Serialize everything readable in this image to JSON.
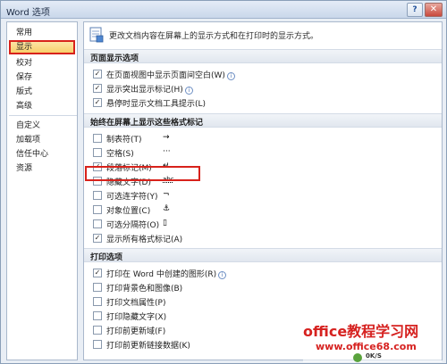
{
  "window": {
    "title": "Word 选项",
    "help": "?",
    "close": "✕"
  },
  "sidebar": {
    "items": [
      {
        "label": "常用"
      },
      {
        "label": "显示"
      },
      {
        "label": "校对"
      },
      {
        "label": "保存"
      },
      {
        "label": "版式"
      },
      {
        "label": "高级"
      },
      {
        "label": "自定义"
      },
      {
        "label": "加载项"
      },
      {
        "label": "信任中心"
      },
      {
        "label": "资源"
      }
    ],
    "selected": "显示"
  },
  "main": {
    "banner_text": "更改文档内容在屏幕上的显示方式和在打印时的显示方式。",
    "sections": [
      {
        "title": "页面显示选项",
        "options": [
          {
            "label": "在页面视图中显示页面间空白(W)",
            "checked": true,
            "info": true
          },
          {
            "label": "显示突出显示标记(H)",
            "checked": true,
            "info": true
          },
          {
            "label": "悬停时显示文档工具提示(L)",
            "checked": true,
            "info": false
          }
        ]
      },
      {
        "title": "始终在屏幕上显示这些格式标记",
        "options": [
          {
            "label": "制表符(T)",
            "checked": false,
            "mark": "→"
          },
          {
            "label": "空格(S)",
            "checked": false,
            "mark": "···"
          },
          {
            "label": "段落标记(M)",
            "checked": true,
            "mark": "↵"
          },
          {
            "label": "隐藏文字(D)",
            "checked": false,
            "mark": "abc"
          },
          {
            "label": "可选连字符(Y)",
            "checked": false,
            "mark": "¬"
          },
          {
            "label": "对象位置(C)",
            "checked": false,
            "mark": "⚓"
          },
          {
            "label": "可选分隔符(O)",
            "checked": false,
            "mark": "▯"
          },
          {
            "label": "显示所有格式标记(A)",
            "checked": true,
            "mark": ""
          }
        ]
      },
      {
        "title": "打印选项",
        "options": [
          {
            "label": "打印在 Word 中创建的图形(R)",
            "checked": true,
            "info": true
          },
          {
            "label": "打印背景色和图像(B)",
            "checked": false,
            "info": false
          },
          {
            "label": "打印文档属性(P)",
            "checked": false,
            "info": false
          },
          {
            "label": "打印隐藏文字(X)",
            "checked": false,
            "info": false
          },
          {
            "label": "打印前更新域(F)",
            "checked": false,
            "info": false
          },
          {
            "label": "打印前更新链接数据(K)",
            "checked": false,
            "info": false
          }
        ]
      }
    ]
  },
  "footer": {
    "ok_label": "0K/S"
  },
  "watermark": {
    "title": "office教程学习网",
    "url": "www.office68.com"
  },
  "colors": {
    "highlight_border": "#d8221b",
    "selected_bg": "#f8cf6b",
    "section_bg": "#e1e7ef"
  }
}
